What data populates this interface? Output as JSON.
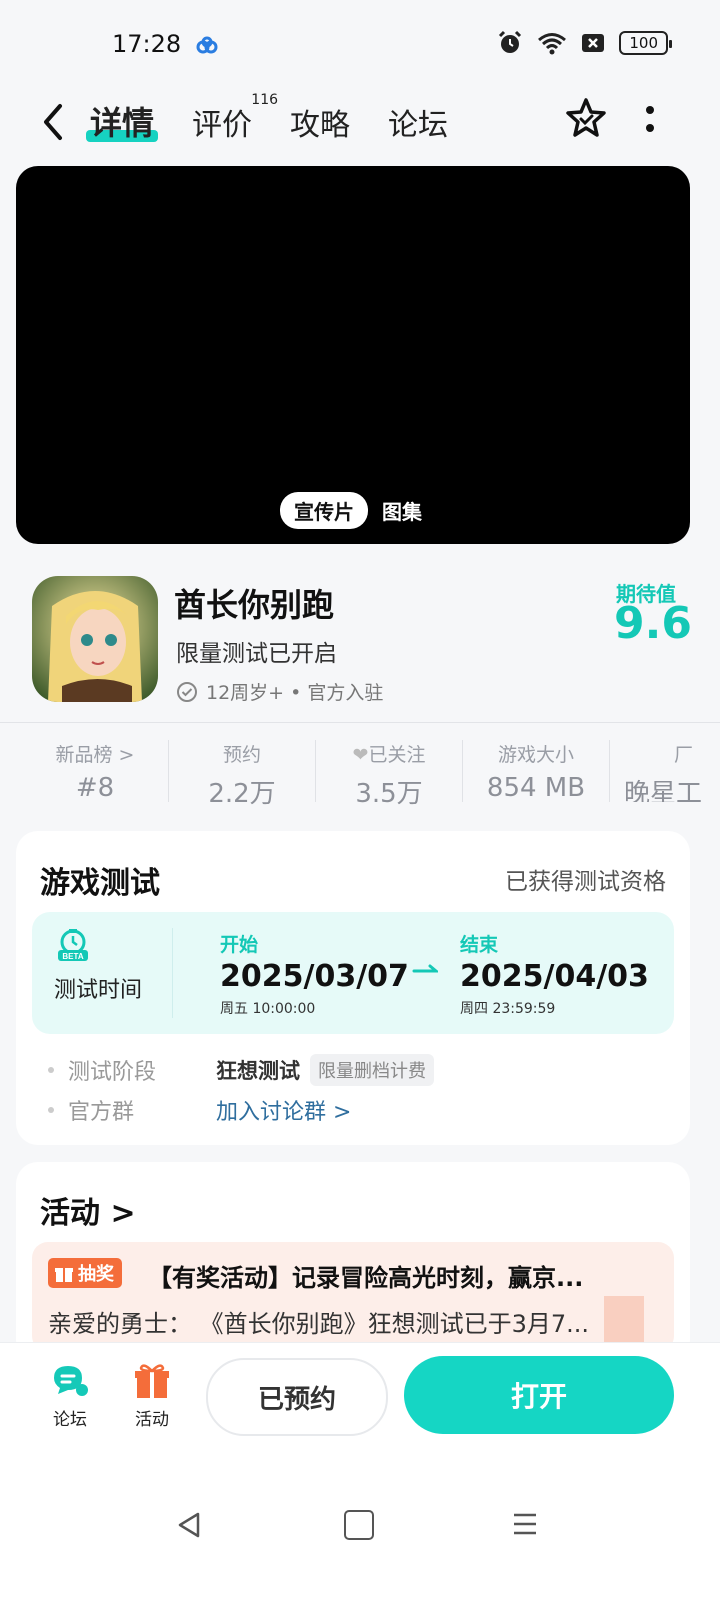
{
  "status_bar": {
    "time": "17:28",
    "battery": "100"
  },
  "header": {
    "tabs": [
      {
        "label": "详情"
      },
      {
        "label": "评价",
        "badge": "116"
      },
      {
        "label": "攻略"
      },
      {
        "label": "论坛"
      }
    ]
  },
  "media": {
    "tab_active": "宣传片",
    "tab_other": "图集"
  },
  "app": {
    "name": "酋长你别跑",
    "subtitle": "限量测试已开启",
    "meta": "12周岁+ • 官方入驻",
    "expect_label": "期待值",
    "expect_value": "9.6"
  },
  "stats": [
    {
      "label": "新品榜 >",
      "value": "#8"
    },
    {
      "label": "预约",
      "value": "2.2万"
    },
    {
      "label": "已关注",
      "value": "3.5万"
    },
    {
      "label": "游戏大小",
      "value": "854 MB"
    },
    {
      "label": "厂",
      "value": "晚星工"
    }
  ],
  "test": {
    "title": "游戏测试",
    "status": "已获得测试资格",
    "time_label": "测试时间",
    "start_label": "开始",
    "start_date": "2025/03/07",
    "start_detail": "周五  10:00:00",
    "end_label": "结束",
    "end_date": "2025/04/03",
    "end_detail": "周四  23:59:59",
    "stage_label": "测试阶段",
    "stage_value": "狂想测试",
    "stage_tag": "限量删档计费",
    "group_label": "官方群",
    "group_link": "加入讨论群 >"
  },
  "activity": {
    "title": "活动 >",
    "tag": "抽奖",
    "headline": "【有奖活动】记录冒险高光时刻，赢京...",
    "body": "亲爱的勇士：  《酋长你别跑》狂想测试已于3月7..."
  },
  "bottom": {
    "forum": "论坛",
    "activity": "活动",
    "reserved": "已预约",
    "open": "打开"
  },
  "colors": {
    "accent": "#15d6c4",
    "lottery": "#f46d3a",
    "link": "#2f6e9e"
  }
}
